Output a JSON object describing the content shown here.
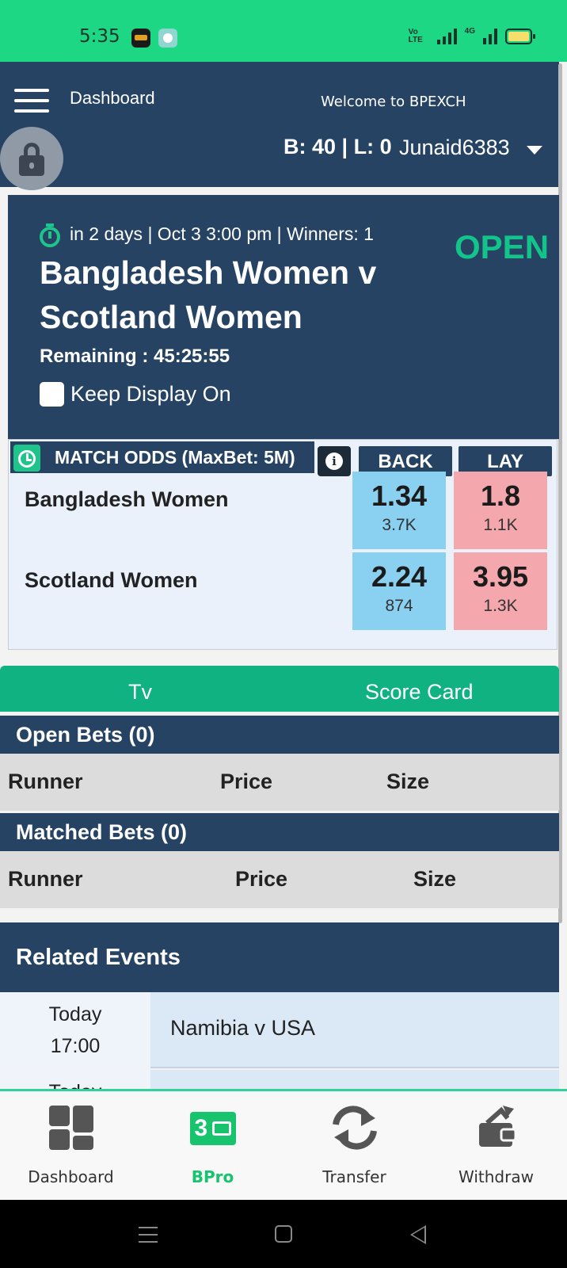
{
  "status_bar": {
    "time": "5:35",
    "volte": "Vo LTE",
    "network": "4G"
  },
  "header": {
    "nav_title": "Dashboard",
    "welcome": "Welcome to BPEXCH",
    "balance": "B: 40 | L: 0",
    "username": "Junaid6383"
  },
  "match": {
    "meta": "in 2 days | Oct 3 3:00 pm | Winners: 1",
    "status": "OPEN",
    "title": "Bangladesh Women v Scotland Women",
    "remaining": "Remaining : 45:25:55",
    "keep_display_label": "Keep Display On"
  },
  "odds": {
    "title": "MATCH ODDS (MaxBet: 5M)",
    "back_label": "BACK",
    "lay_label": "LAY",
    "runners": [
      {
        "name": "Bangladesh Women",
        "back_price": "1.34",
        "back_size": "3.7K",
        "lay_price": "1.8",
        "lay_size": "1.1K"
      },
      {
        "name": "Scotland Women",
        "back_price": "2.24",
        "back_size": "874",
        "lay_price": "3.95",
        "lay_size": "1.3K"
      }
    ]
  },
  "tabs": {
    "tv": "Tv",
    "score_card": "Score Card"
  },
  "open_bets": {
    "title": "Open Bets (0)",
    "columns": [
      "Runner",
      "Price",
      "Size"
    ]
  },
  "matched_bets": {
    "title": "Matched Bets (0)",
    "columns": [
      "Runner",
      "Price",
      "Size"
    ]
  },
  "related_events": {
    "title": "Related Events",
    "items": [
      {
        "date_line1": "Today",
        "date_line2": "17:00",
        "name": "Namibia v USA"
      },
      {
        "date_line1": "Today",
        "date_line2": "",
        "name": ""
      }
    ]
  },
  "bottom_nav": [
    {
      "label": "Dashboard",
      "icon": "dashboard-icon"
    },
    {
      "label": "BPro",
      "icon": "bpro-icon"
    },
    {
      "label": "Transfer",
      "icon": "transfer-icon"
    },
    {
      "label": "Withdraw",
      "icon": "withdraw-icon"
    }
  ],
  "colors": {
    "status_bar": "#1ed784",
    "navy": "#264364",
    "accent_green": "#12c38a",
    "back": "#8ad0f0",
    "lay": "#f4a8ae"
  }
}
